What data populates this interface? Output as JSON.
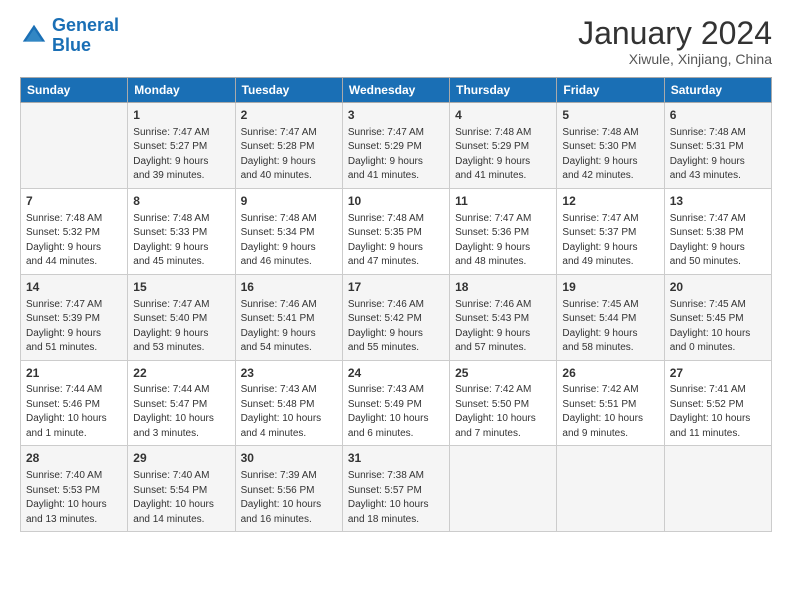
{
  "logo": {
    "line1": "General",
    "line2": "Blue"
  },
  "title": "January 2024",
  "subtitle": "Xiwule, Xinjiang, China",
  "headers": [
    "Sunday",
    "Monday",
    "Tuesday",
    "Wednesday",
    "Thursday",
    "Friday",
    "Saturday"
  ],
  "weeks": [
    [
      {
        "day": "",
        "text": ""
      },
      {
        "day": "1",
        "text": "Sunrise: 7:47 AM\nSunset: 5:27 PM\nDaylight: 9 hours\nand 39 minutes."
      },
      {
        "day": "2",
        "text": "Sunrise: 7:47 AM\nSunset: 5:28 PM\nDaylight: 9 hours\nand 40 minutes."
      },
      {
        "day": "3",
        "text": "Sunrise: 7:47 AM\nSunset: 5:29 PM\nDaylight: 9 hours\nand 41 minutes."
      },
      {
        "day": "4",
        "text": "Sunrise: 7:48 AM\nSunset: 5:29 PM\nDaylight: 9 hours\nand 41 minutes."
      },
      {
        "day": "5",
        "text": "Sunrise: 7:48 AM\nSunset: 5:30 PM\nDaylight: 9 hours\nand 42 minutes."
      },
      {
        "day": "6",
        "text": "Sunrise: 7:48 AM\nSunset: 5:31 PM\nDaylight: 9 hours\nand 43 minutes."
      }
    ],
    [
      {
        "day": "7",
        "text": "Sunrise: 7:48 AM\nSunset: 5:32 PM\nDaylight: 9 hours\nand 44 minutes."
      },
      {
        "day": "8",
        "text": "Sunrise: 7:48 AM\nSunset: 5:33 PM\nDaylight: 9 hours\nand 45 minutes."
      },
      {
        "day": "9",
        "text": "Sunrise: 7:48 AM\nSunset: 5:34 PM\nDaylight: 9 hours\nand 46 minutes."
      },
      {
        "day": "10",
        "text": "Sunrise: 7:48 AM\nSunset: 5:35 PM\nDaylight: 9 hours\nand 47 minutes."
      },
      {
        "day": "11",
        "text": "Sunrise: 7:47 AM\nSunset: 5:36 PM\nDaylight: 9 hours\nand 48 minutes."
      },
      {
        "day": "12",
        "text": "Sunrise: 7:47 AM\nSunset: 5:37 PM\nDaylight: 9 hours\nand 49 minutes."
      },
      {
        "day": "13",
        "text": "Sunrise: 7:47 AM\nSunset: 5:38 PM\nDaylight: 9 hours\nand 50 minutes."
      }
    ],
    [
      {
        "day": "14",
        "text": "Sunrise: 7:47 AM\nSunset: 5:39 PM\nDaylight: 9 hours\nand 51 minutes."
      },
      {
        "day": "15",
        "text": "Sunrise: 7:47 AM\nSunset: 5:40 PM\nDaylight: 9 hours\nand 53 minutes."
      },
      {
        "day": "16",
        "text": "Sunrise: 7:46 AM\nSunset: 5:41 PM\nDaylight: 9 hours\nand 54 minutes."
      },
      {
        "day": "17",
        "text": "Sunrise: 7:46 AM\nSunset: 5:42 PM\nDaylight: 9 hours\nand 55 minutes."
      },
      {
        "day": "18",
        "text": "Sunrise: 7:46 AM\nSunset: 5:43 PM\nDaylight: 9 hours\nand 57 minutes."
      },
      {
        "day": "19",
        "text": "Sunrise: 7:45 AM\nSunset: 5:44 PM\nDaylight: 9 hours\nand 58 minutes."
      },
      {
        "day": "20",
        "text": "Sunrise: 7:45 AM\nSunset: 5:45 PM\nDaylight: 10 hours\nand 0 minutes."
      }
    ],
    [
      {
        "day": "21",
        "text": "Sunrise: 7:44 AM\nSunset: 5:46 PM\nDaylight: 10 hours\nand 1 minute."
      },
      {
        "day": "22",
        "text": "Sunrise: 7:44 AM\nSunset: 5:47 PM\nDaylight: 10 hours\nand 3 minutes."
      },
      {
        "day": "23",
        "text": "Sunrise: 7:43 AM\nSunset: 5:48 PM\nDaylight: 10 hours\nand 4 minutes."
      },
      {
        "day": "24",
        "text": "Sunrise: 7:43 AM\nSunset: 5:49 PM\nDaylight: 10 hours\nand 6 minutes."
      },
      {
        "day": "25",
        "text": "Sunrise: 7:42 AM\nSunset: 5:50 PM\nDaylight: 10 hours\nand 7 minutes."
      },
      {
        "day": "26",
        "text": "Sunrise: 7:42 AM\nSunset: 5:51 PM\nDaylight: 10 hours\nand 9 minutes."
      },
      {
        "day": "27",
        "text": "Sunrise: 7:41 AM\nSunset: 5:52 PM\nDaylight: 10 hours\nand 11 minutes."
      }
    ],
    [
      {
        "day": "28",
        "text": "Sunrise: 7:40 AM\nSunset: 5:53 PM\nDaylight: 10 hours\nand 13 minutes."
      },
      {
        "day": "29",
        "text": "Sunrise: 7:40 AM\nSunset: 5:54 PM\nDaylight: 10 hours\nand 14 minutes."
      },
      {
        "day": "30",
        "text": "Sunrise: 7:39 AM\nSunset: 5:56 PM\nDaylight: 10 hours\nand 16 minutes."
      },
      {
        "day": "31",
        "text": "Sunrise: 7:38 AM\nSunset: 5:57 PM\nDaylight: 10 hours\nand 18 minutes."
      },
      {
        "day": "",
        "text": ""
      },
      {
        "day": "",
        "text": ""
      },
      {
        "day": "",
        "text": ""
      }
    ]
  ]
}
